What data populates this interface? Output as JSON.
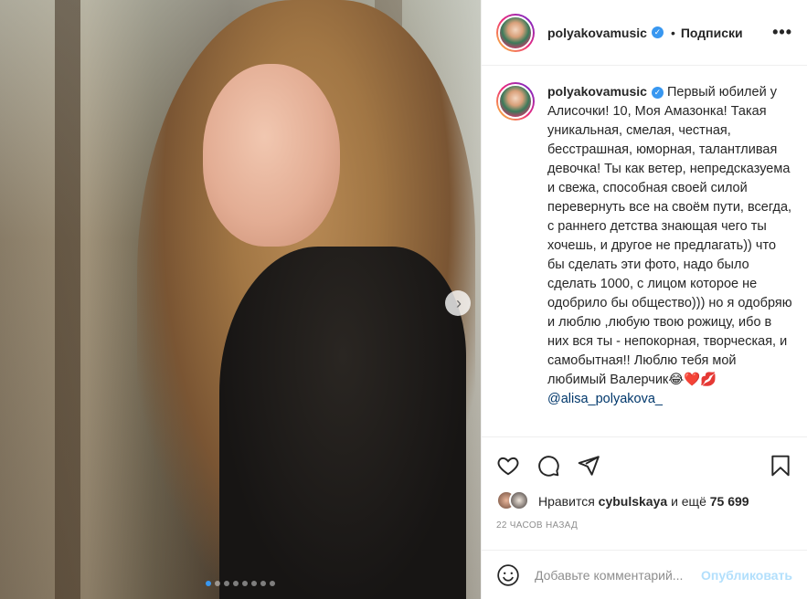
{
  "header": {
    "username": "polyakovamusic",
    "verified_icon": "verified-icon",
    "bullet": "•",
    "follow_label": "Подписки",
    "more_label": "•••"
  },
  "caption": {
    "username": "polyakovamusic",
    "text": "Первый юбилей у Алисочки! 10, Моя Амазонка! Такая уникальная, смелая, честная, бесстрашная, юморная, талантливая девочка! Ты как ветер, непредсказуема и свежа, способная своей силой перевернуть все на своём пути, всегда, с раннего детства знающая чего ты хочешь, и другое не предлагать)) что бы сделать эти фото, надо было сделать 1000, с лицом которое не одобрило бы общество))) но я одобряю и люблю ,любую твою рожицу, ибо в них вся ты - непокорная, творческая, и самобытная!! Люблю тебя мой любимый Валерчик😂❤️💋",
    "mention": "@alisa_polyakova_"
  },
  "actions": {
    "icons": [
      "heart-icon",
      "comment-icon",
      "share-icon",
      "bookmark-icon"
    ]
  },
  "likes": {
    "prefix": "Нравится",
    "user": "cybulskaya",
    "middle": "и ещё",
    "count": "75 699"
  },
  "timestamp": "22 часов назад",
  "comment": {
    "placeholder": "Добавьте комментарий...",
    "publish_label": "Опубликовать"
  },
  "carousel": {
    "total_slides": 8,
    "active_index": 0,
    "next_glyph": "›"
  },
  "colors": {
    "accent": "#3897f0",
    "publish_disabled": "#b2dffc",
    "muted": "#8e8e8e",
    "text": "#262626"
  }
}
